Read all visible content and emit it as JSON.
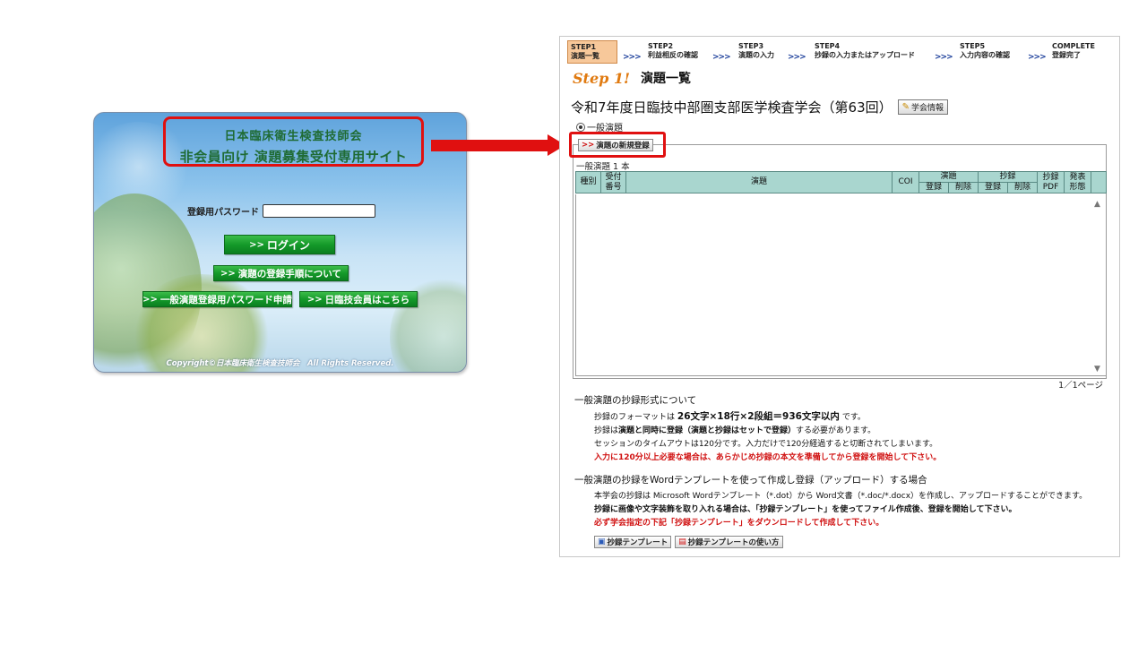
{
  "login": {
    "title_line1": "日本臨床衛生検査技師会",
    "title_line2": "非会員向け 演題募集受付専用サイト",
    "password_label": "登録用パスワード",
    "password_value": "",
    "login_button": "ログイン",
    "howto_button": "演題の登録手順について",
    "password_request_button": "一般演題登録用パスワード申請",
    "member_button": "日臨技会員はこちら",
    "chevron": ">>",
    "copyright": "Copyright©日本臨床衛生検査技師会　All Rights Reserved."
  },
  "steps": [
    {
      "num": "STEP1",
      "label": "演題一覧"
    },
    {
      "num": "STEP2",
      "label": "利益相反の確認"
    },
    {
      "num": "STEP3",
      "label": "演題の入力"
    },
    {
      "num": "STEP4",
      "label": "抄録の入力またはアップロード"
    },
    {
      "num": "STEP5",
      "label": "入力内容の確認"
    },
    {
      "num": "COMPLETE",
      "label": "登録完了"
    }
  ],
  "step_chevron": ">>>",
  "step_heading": {
    "step": "Step 1!",
    "title": "演題一覧"
  },
  "conference_title": "令和7年度日臨技中部圏支部医学検査学会（第63回）",
  "info_button": "学会情報",
  "radio_label": "一般演題",
  "new_registration_button": "演題の新規登録",
  "count_text": "一般演題 1 本",
  "table": {
    "type": "種別",
    "receipt_number_1": "受付",
    "receipt_number_2": "番号",
    "title": "演題",
    "coi": "COI",
    "presentation": "演題",
    "abstract": "抄録",
    "register": "登録",
    "delete": "削除",
    "abstract_pdf_1": "抄録",
    "abstract_pdf_2": "PDF",
    "format_1": "発表",
    "format_2": "形態"
  },
  "pager": "1／1ページ",
  "abstract_format": {
    "heading": "一般演題の抄録形式について",
    "line1_prefix": "抄録のフォーマットは",
    "line1_bold": "26文字×18行×2段組＝936文字以内",
    "line1_suffix": "です。",
    "line2_prefix": "抄録は",
    "line2_bold": "演題と同時に登録（演題と抄録はセットで登録）",
    "line2_suffix": "する必要があります。",
    "line3": "セッションのタイムアウトは120分です。入力だけで120分経過すると切断されてしまいます。",
    "line4": "入力に120分以上必要な場合は、あらかじめ抄録の本文を準備してから登録を開始して下さい。"
  },
  "word_template": {
    "heading": "一般演題の抄録をWordテンプレートを使って作成し登録（アップロード）する場合",
    "line1": "本学会の抄録は Microsoft Wordテンプレート（*.dot）から Word文書（*.doc/*.docx）を作成し、アップロードすることができます。",
    "line2": "抄録に画像や文字装飾を取り入れる場合は、「抄録テンプレート」を使ってファイル作成後、登録を開始して下さい。",
    "line3": "必ず学会指定の下記「抄録テンプレート」をダウンロードして作成して下さい。",
    "template_button": "抄録テンプレート",
    "usage_button": "抄録テンプレートの使い方"
  },
  "colors": {
    "highlight": "#e01010",
    "table_header": "#a9d6cf",
    "button_green": "#159a2a",
    "step_active": "#f7c89a"
  }
}
